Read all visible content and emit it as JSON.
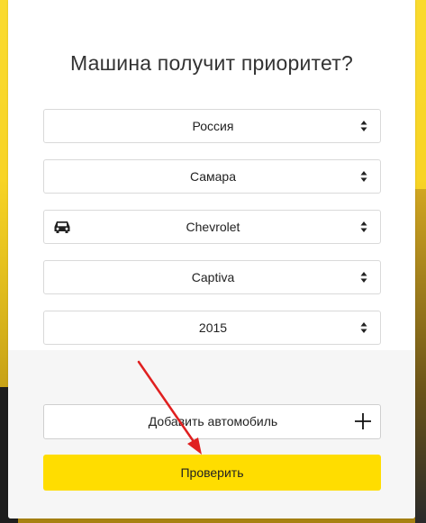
{
  "form": {
    "title": "Машина получит приоритет?",
    "selects": [
      {
        "value": "Россия",
        "has_icon": false
      },
      {
        "value": "Самара",
        "has_icon": false
      },
      {
        "value": "Chevrolet",
        "has_icon": true,
        "icon": "car-icon"
      },
      {
        "value": "Captiva",
        "has_icon": false
      },
      {
        "value": "2015",
        "has_icon": false
      }
    ],
    "add_car_label": "Добавить автомобиль",
    "check_label": "Проверить"
  },
  "colors": {
    "accent_button": "#ffdd00",
    "background": "#fadb2e",
    "annotation_arrow": "#e02020"
  }
}
